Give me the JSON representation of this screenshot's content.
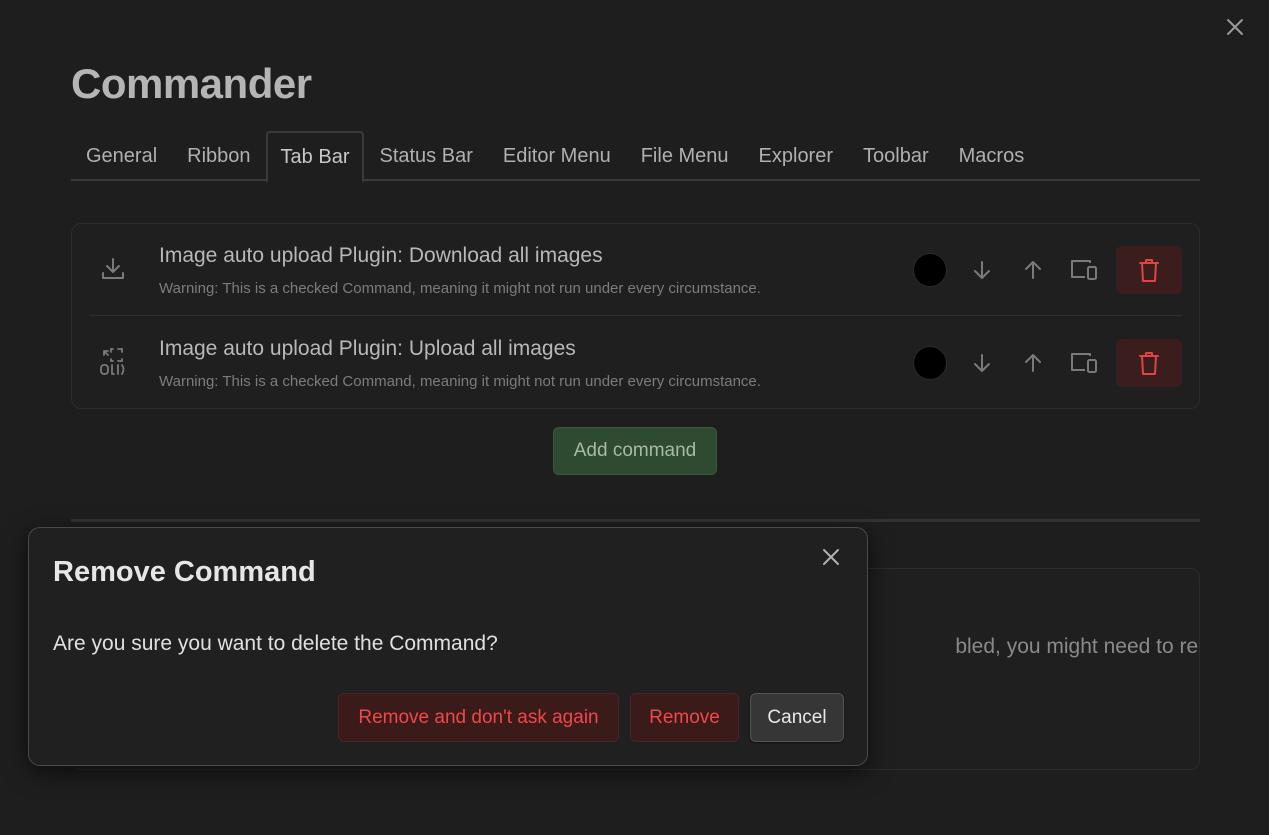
{
  "settings": {
    "title": "Commander",
    "tabs": [
      {
        "label": "General",
        "active": false
      },
      {
        "label": "Ribbon",
        "active": false
      },
      {
        "label": "Tab Bar",
        "active": true
      },
      {
        "label": "Status Bar",
        "active": false
      },
      {
        "label": "Editor Menu",
        "active": false
      },
      {
        "label": "File Menu",
        "active": false
      },
      {
        "label": "Explorer",
        "active": false
      },
      {
        "label": "Toolbar",
        "active": false
      },
      {
        "label": "Macros",
        "active": false
      }
    ],
    "commands": [
      {
        "icon": "download-icon",
        "name": "Image auto upload Plugin: Download all images",
        "warning": "Warning: This is a checked Command, meaning it might not run under every circumstance."
      },
      {
        "icon": "upload-frame-icon",
        "name": "Image auto upload Plugin: Upload all images",
        "warning": "Warning: This is a checked Command, meaning it might not run under every circumstance."
      }
    ],
    "add_command_label": "Add command",
    "background_card_text": "bled, you might need to restart"
  },
  "modal": {
    "title": "Remove Command",
    "body": "Are you sure you want to delete the Command?",
    "buttons": {
      "remove_dont_ask": "Remove and don't ask again",
      "remove": "Remove",
      "cancel": "Cancel"
    }
  },
  "colors": {
    "background": "#1e1e1e",
    "danger_text": "#f04848",
    "danger_bg": "#3b1a1a",
    "add_button_bg": "#2e4a30",
    "command_color_dot": "#000000"
  }
}
